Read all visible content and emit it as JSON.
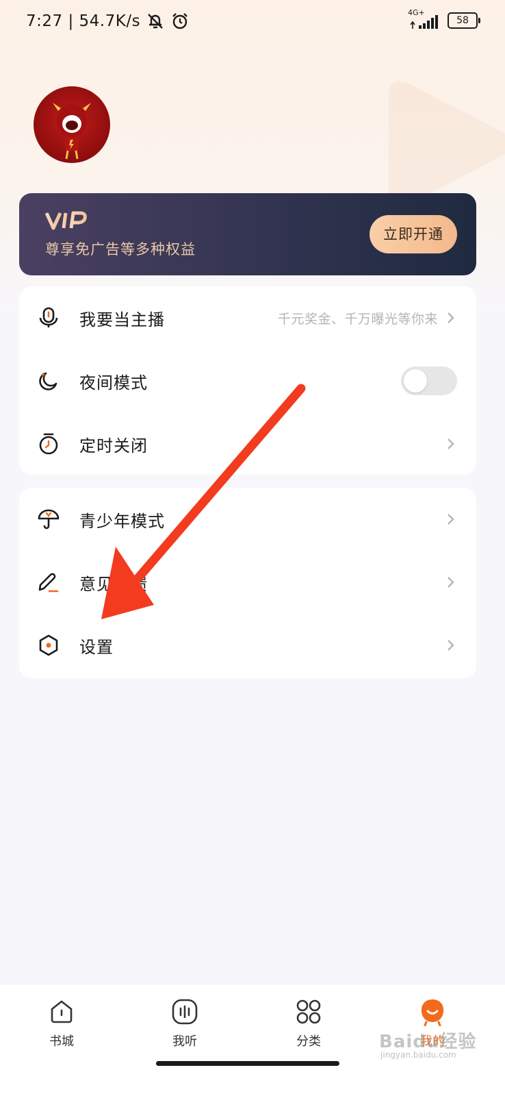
{
  "status_bar": {
    "time_speed": "7:27 | 54.7K/s",
    "network": "4G+",
    "battery": "58"
  },
  "vip": {
    "logo": "VIP",
    "subtitle": "尊享免广告等多种权益",
    "button": "立即开通"
  },
  "menu_group_1": [
    {
      "icon": "microphone-icon",
      "label": "我要当主播",
      "hint": "千元奖金、千万曝光等你来"
    },
    {
      "icon": "moon-icon",
      "label": "夜间模式",
      "toggle_on": false
    },
    {
      "icon": "timer-icon",
      "label": "定时关闭"
    }
  ],
  "menu_group_2": [
    {
      "icon": "umbrella-icon",
      "label": "青少年模式"
    },
    {
      "icon": "pen-icon",
      "label": "意见反馈"
    },
    {
      "icon": "hexagon-settings-icon",
      "label": "设置"
    }
  ],
  "bottom_nav": [
    {
      "icon": "house-icon",
      "label": "书城"
    },
    {
      "icon": "audio-wave-icon",
      "label": "我听"
    },
    {
      "icon": "grid-icon",
      "label": "分类"
    },
    {
      "icon": "mascot-icon",
      "label": "我的",
      "active": true
    }
  ],
  "watermark": {
    "text": "Baidu经验",
    "sub": "jingyan.baidu.com"
  },
  "colors": {
    "accent": "#f26a1b",
    "vip_gold": "#eac7a7",
    "annotation_arrow": "#f23b1f"
  }
}
